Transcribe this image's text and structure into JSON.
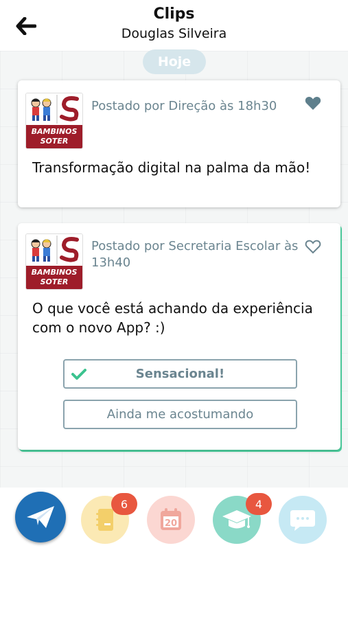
{
  "header": {
    "title": "Clips",
    "subtitle": "Douglas Silveira",
    "back_icon": "arrow-left-icon"
  },
  "feed": {
    "date_label": "Hoje",
    "posts": [
      {
        "logo_text_line1": "BAMBINOS",
        "logo_text_line2": "SOTER",
        "meta": "Postado por Direção às 18h30",
        "liked": true,
        "heart_color": "#5e7f8c",
        "body": "Transformação digital na palma da mão!"
      },
      {
        "logo_text_line1": "BAMBINOS",
        "logo_text_line2": "SOTER",
        "meta": "Postado por Secretaria Escolar às 13h40",
        "liked": false,
        "heart_color": "#6b8590",
        "body": "O que você está achando da experiência com o novo App? :)",
        "poll": {
          "options": [
            {
              "label": "Sensacional!",
              "selected": true
            },
            {
              "label": "Ainda me acostumando",
              "selected": false
            }
          ],
          "check_color": "#3cc38f"
        }
      }
    ]
  },
  "bottom_nav": {
    "items": [
      {
        "name": "send",
        "icon": "paper-plane-icon",
        "color": "#1f6fb5"
      },
      {
        "name": "notes",
        "icon": "notebook-icon",
        "color": "#fbe9b4",
        "badge": "6"
      },
      {
        "name": "calendar",
        "icon": "calendar-icon",
        "color": "#fbd7d2",
        "calendar_day": "20"
      },
      {
        "name": "school",
        "icon": "graduation-cap-icon",
        "color": "#8ad9c7",
        "badge": "4"
      },
      {
        "name": "chat",
        "icon": "chat-bubble-icon",
        "color": "#c6e9f4"
      }
    ],
    "badge_color": "#e8573f"
  }
}
